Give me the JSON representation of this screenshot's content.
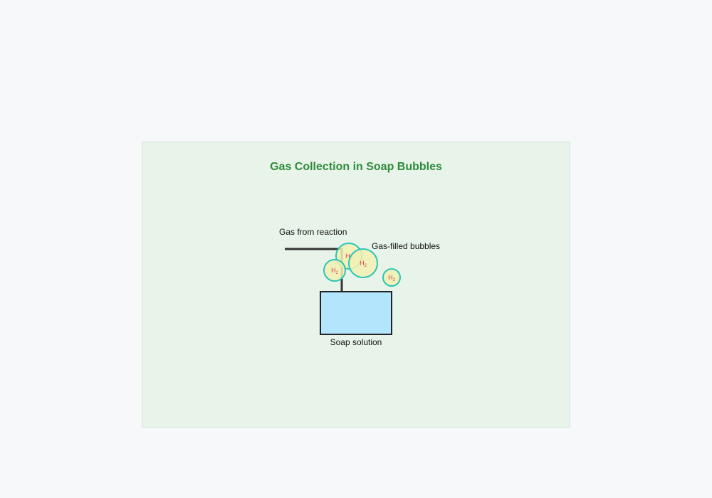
{
  "title": "Gas Collection in Soap Bubbles",
  "labels": {
    "gas_source": "Gas from reaction",
    "bubbles": "Gas-filled bubbles",
    "solution": "Soap solution"
  },
  "bubble_gas": {
    "main": "H",
    "sub": "2"
  },
  "colors": {
    "title": "#2e8b3a",
    "panel": "#e8f4e9",
    "bubble_fill": "#f3f0b4",
    "bubble_stroke": "#2cc5b5",
    "solution_fill": "#b3e5fc",
    "tube": "#333333",
    "gas_text": "#d2453b"
  }
}
